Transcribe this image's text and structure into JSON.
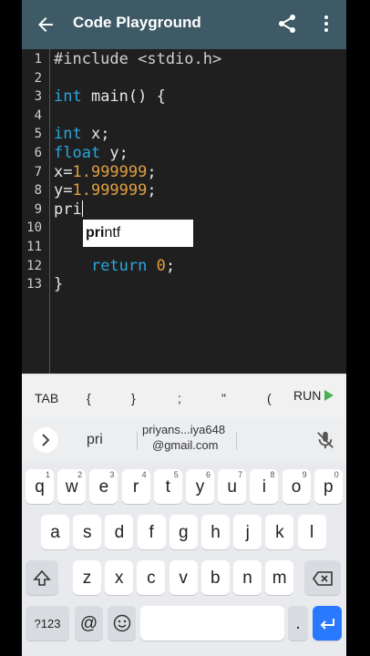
{
  "app": {
    "title": "Code Playground"
  },
  "editor": {
    "line_numbers": [
      "1",
      "2",
      "3",
      "4",
      "5",
      "6",
      "7",
      "8",
      "9",
      "10",
      "11",
      "12",
      "13"
    ],
    "lines": [
      {
        "indent": "",
        "parts": [
          {
            "t": "#include <stdio.h>",
            "c": "str"
          }
        ]
      },
      {
        "indent": "",
        "parts": []
      },
      {
        "indent": "",
        "parts": [
          {
            "t": "int",
            "c": "kw"
          },
          {
            "t": " main() {",
            "c": ""
          }
        ]
      },
      {
        "indent": "",
        "parts": []
      },
      {
        "indent": "",
        "parts": [
          {
            "t": "int",
            "c": "kw"
          },
          {
            "t": " x;",
            "c": ""
          }
        ]
      },
      {
        "indent": "",
        "parts": [
          {
            "t": "float",
            "c": "kw"
          },
          {
            "t": " y;",
            "c": ""
          }
        ]
      },
      {
        "indent": "",
        "parts": [
          {
            "t": "x=",
            "c": ""
          },
          {
            "t": "1.999999",
            "c": "num"
          },
          {
            "t": ";",
            "c": ""
          }
        ]
      },
      {
        "indent": "",
        "parts": [
          {
            "t": "y=",
            "c": ""
          },
          {
            "t": "1.999999",
            "c": "num"
          },
          {
            "t": ";",
            "c": ""
          }
        ]
      },
      {
        "indent": "",
        "parts": [
          {
            "t": "pri",
            "c": ""
          }
        ]
      },
      {
        "indent": "",
        "parts": []
      },
      {
        "indent": "",
        "parts": []
      },
      {
        "indent": "    ",
        "parts": [
          {
            "t": "return",
            "c": "kw"
          },
          {
            "t": " ",
            "c": ""
          },
          {
            "t": "0",
            "c": "num"
          },
          {
            "t": ";",
            "c": ""
          }
        ]
      },
      {
        "indent": "",
        "parts": [
          {
            "t": "}",
            "c": ""
          }
        ]
      }
    ],
    "autocomplete": {
      "match": "pri",
      "rest": "ntf"
    }
  },
  "keybar": {
    "items": [
      "TAB",
      "{",
      "}",
      ";",
      "\"",
      "("
    ],
    "run": "RUN"
  },
  "suggestions": {
    "word": "pri",
    "email_line1": "priyans...iya648",
    "email_line2": "@gmail.com"
  },
  "keyboard": {
    "row1": [
      {
        "k": "q",
        "s": "1"
      },
      {
        "k": "w",
        "s": "2"
      },
      {
        "k": "e",
        "s": "3"
      },
      {
        "k": "r",
        "s": "4"
      },
      {
        "k": "t",
        "s": "5"
      },
      {
        "k": "y",
        "s": "6"
      },
      {
        "k": "u",
        "s": "7"
      },
      {
        "k": "i",
        "s": "8"
      },
      {
        "k": "o",
        "s": "9"
      },
      {
        "k": "p",
        "s": "0"
      }
    ],
    "row2": [
      "a",
      "s",
      "d",
      "f",
      "g",
      "h",
      "j",
      "k",
      "l"
    ],
    "row3": [
      "z",
      "x",
      "c",
      "v",
      "b",
      "n",
      "m"
    ],
    "sym": "?123",
    "at": "@",
    "period": "."
  }
}
